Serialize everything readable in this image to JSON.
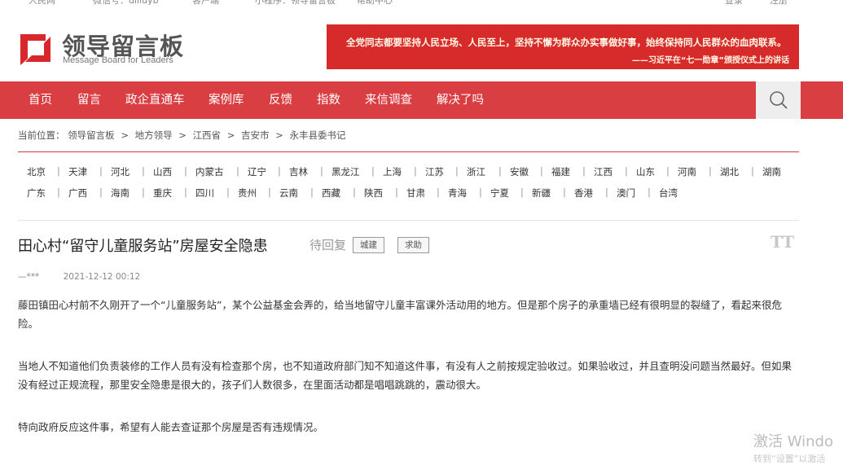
{
  "topbar": {
    "items": [
      "人民网",
      "微信号：dlliuyb",
      "客户端",
      "小程序：领导留言板",
      "帮助中心",
      "登录",
      "注册"
    ]
  },
  "logo": {
    "title": "领导留言板",
    "subtitle": "Message Board for Leaders"
  },
  "banner": {
    "quote": "全党同志都要坚持人民立场、人民至上，坚持不懈为群众办实事做好事，始终保持同人民群众的血肉联系。",
    "source": "——习近平在“七一勋章”颁授仪式上的讲话"
  },
  "nav": {
    "items": [
      "首页",
      "留言",
      "政企直通车",
      "案例库",
      "反馈",
      "指数",
      "来信调查",
      "解决了吗"
    ]
  },
  "breadcrumb": {
    "prefix": "当前位置：",
    "items": [
      "领导留言板",
      "地方领导",
      "江西省",
      "吉安市",
      "永丰县委书记"
    ],
    "separator": ">"
  },
  "regions": {
    "row1": [
      "北京",
      "天津",
      "河北",
      "山西",
      "内蒙古",
      "辽宁",
      "吉林",
      "黑龙江",
      "上海",
      "江苏",
      "浙江",
      "安徽",
      "福建",
      "江西",
      "山东",
      "河南",
      "湖北",
      "湖南"
    ],
    "row2": [
      "广东",
      "广西",
      "海南",
      "重庆",
      "四川",
      "贵州",
      "云南",
      "西藏",
      "陕西",
      "甘肃",
      "青海",
      "宁夏",
      "新疆",
      "香港",
      "澳门",
      "台湾"
    ],
    "separator": "|"
  },
  "message": {
    "title": "田心村“留守儿童服务站”房屋安全隐患",
    "status": "待回复",
    "tags": [
      "城建",
      "求助"
    ],
    "font_toggle": "TT",
    "author": "—***",
    "datetime": "2021-12-12 00:12",
    "paragraphs": [
      "藤田镇田心村前不久刚开了一个“儿童服务站”，某个公益基金会弄的，给当地留守儿童丰富课外活动用的地方。但是那个房子的承重墙已经有很明显的裂缝了，看起来很危险。",
      "当地人不知道他们负责装修的工作人员有没有检查那个房，也不知道政府部门知不知道这件事，有没有人之前按规定验收过。如果验收过，并且查明没问题当然最好。但如果没有经过正规流程，那里安全隐患是很大的，孩子们人数很多，在里面活动都是唱唱跳跳的，震动很大。",
      "特向政府反应这件事，希望有人能去查证那个房屋是否有违规情况。"
    ]
  },
  "watermark": {
    "line1": "激活 Windo",
    "line2": "转到“设置”以激活"
  },
  "colors": {
    "nav_red": "#d93e43",
    "banner_red": "#d62b2a",
    "logo_red": "#d8282c"
  }
}
